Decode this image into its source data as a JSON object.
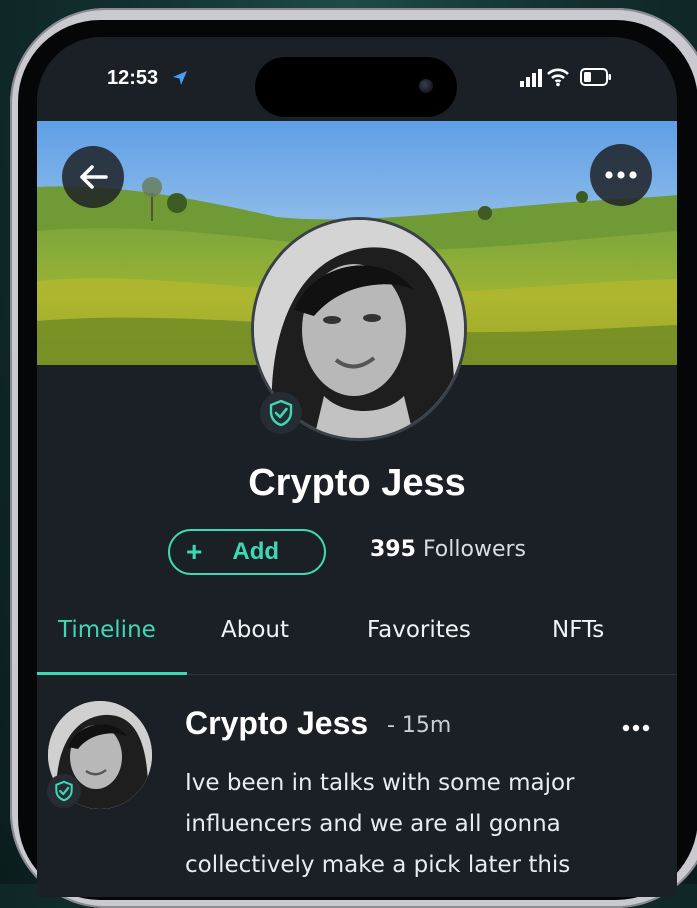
{
  "status_bar": {
    "time": "12:53"
  },
  "profile": {
    "name": "Crypto Jess",
    "add_label": "Add",
    "followers_count": "395",
    "followers_label": "Followers"
  },
  "tabs": [
    {
      "label": "Timeline",
      "active": true
    },
    {
      "label": "About",
      "active": false
    },
    {
      "label": "Favorites",
      "active": false
    },
    {
      "label": "NFTs",
      "active": false
    }
  ],
  "post": {
    "author": "Crypto Jess",
    "time": "- 15m",
    "text": "Ive been in talks with some major influencers and we are all gonna collectively make a pick later this"
  },
  "colors": {
    "accent": "#3fd8b4",
    "background": "#1b2026"
  },
  "icons": [
    "location-arrow-icon",
    "signal-icon",
    "wifi-icon",
    "battery-icon",
    "back-arrow-icon",
    "more-dots-icon",
    "verified-shield-icon"
  ]
}
